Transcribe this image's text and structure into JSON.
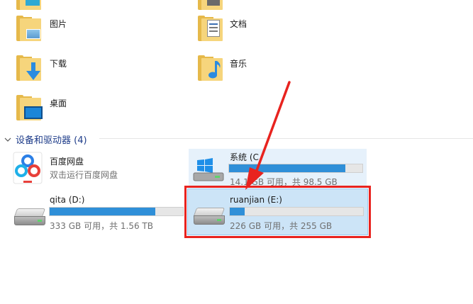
{
  "folders": [
    {
      "label": "图片",
      "icon": "pictures-folder-icon"
    },
    {
      "label": "文档",
      "icon": "documents-folder-icon"
    },
    {
      "label": "下载",
      "icon": "downloads-folder-icon"
    },
    {
      "label": "音乐",
      "icon": "music-folder-icon"
    },
    {
      "label": "桌面",
      "icon": "desktop-folder-icon"
    }
  ],
  "section": {
    "title": "设备和驱动器 (4)"
  },
  "drives": {
    "baidu": {
      "name": "百度网盘",
      "sub": "双击运行百度网盘"
    },
    "system": {
      "name": "系统 (C",
      "sub": "14.1 GB 可用，共 98.5 GB",
      "used_fraction": 0.87
    },
    "qita": {
      "name": "qita (D:)",
      "sub": "333 GB 可用，共 1.56 TB",
      "used_fraction": 0.79
    },
    "ruanjian": {
      "name": "ruanjian (E:)",
      "sub": "226 GB 可用，共 255 GB",
      "used_fraction": 0.11
    }
  },
  "colors": {
    "accent": "#2f8fd8",
    "highlight": "#e8231f",
    "selection": "#cce4f7"
  }
}
